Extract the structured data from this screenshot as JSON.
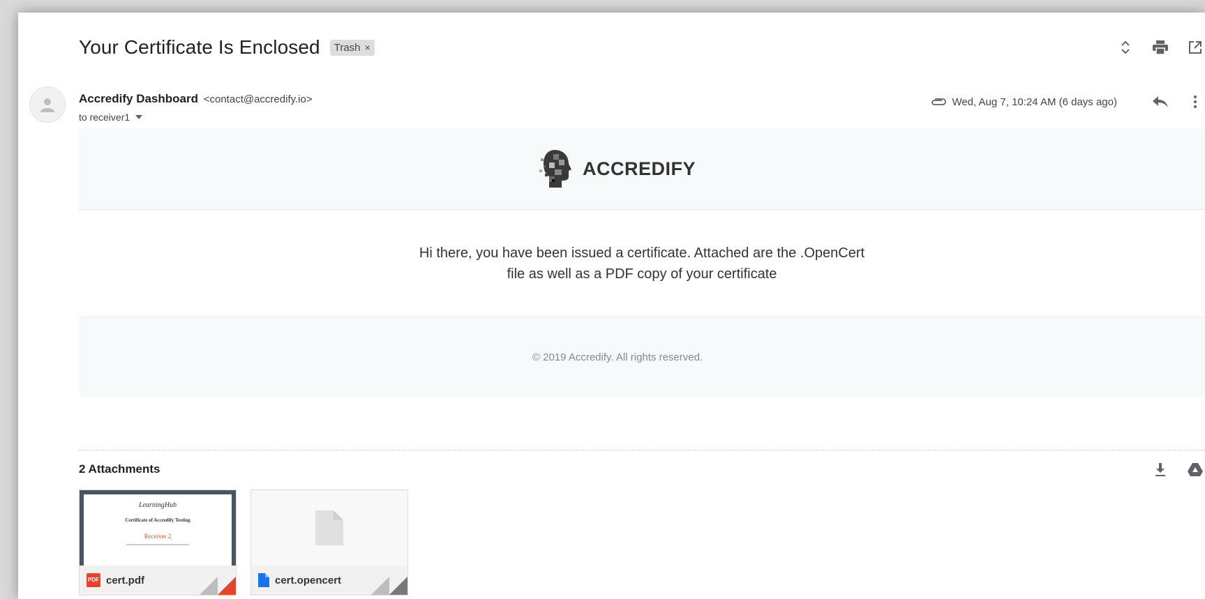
{
  "email": {
    "subject": "Your Certificate Is Enclosed",
    "label": "Trash",
    "label_remove": "×",
    "sender_name": "Accredify Dashboard",
    "sender_email": "<contact@accredify.io>",
    "recipients": "to receiver1",
    "date": "Wed, Aug 7, 10:24 AM (6 days ago)"
  },
  "body": {
    "brand": "ACCREDIFY",
    "message": "Hi there, you have been issued a certificate. Attached are the .OpenCert file as well as a PDF copy of your certificate",
    "footer": "© 2019 Accredify. All rights reserved."
  },
  "attachments": {
    "title": "2 Attachments",
    "items": [
      {
        "name": "cert.pdf",
        "type_badge": "PDF",
        "preview": {
          "logo": "LearningHub",
          "title": "Certificate of Accredify Testing",
          "recipient": "Receiver 2"
        }
      },
      {
        "name": "cert.opencert"
      }
    ]
  },
  "colors": {
    "pdf_red": "#e8432a",
    "file_blue": "#1a73e8",
    "band_bg": "#f6fafa"
  },
  "icons": {
    "top": [
      "expand-collapse-icon",
      "print-icon",
      "open-new-window-icon"
    ],
    "meta": [
      "paperclip-icon",
      "reply-icon",
      "more-vert-icon"
    ],
    "attachments": [
      "download-all-icon",
      "save-to-drive-icon"
    ]
  }
}
